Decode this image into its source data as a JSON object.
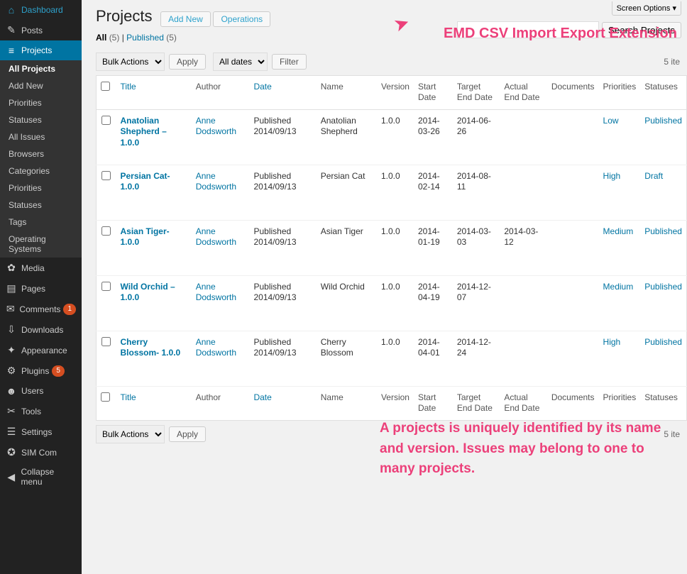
{
  "sidebar": {
    "items": [
      {
        "label": "Dashboard",
        "icon": "⌂"
      },
      {
        "label": "Posts",
        "icon": "✎"
      },
      {
        "label": "Projects",
        "icon": "≡",
        "active": true,
        "submenu": [
          {
            "label": "All Projects",
            "active": true
          },
          {
            "label": "Add New"
          },
          {
            "label": "Priorities"
          },
          {
            "label": "Statuses"
          },
          {
            "label": "All Issues"
          },
          {
            "label": "Browsers"
          },
          {
            "label": "Categories"
          },
          {
            "label": "Priorities"
          },
          {
            "label": "Statuses"
          },
          {
            "label": "Tags"
          },
          {
            "label": "Operating Systems"
          }
        ]
      },
      {
        "label": "Media",
        "icon": "✿"
      },
      {
        "label": "Pages",
        "icon": "▤"
      },
      {
        "label": "Comments",
        "icon": "✉",
        "badge": "1"
      },
      {
        "label": "Downloads",
        "icon": "⇩"
      },
      {
        "label": "Appearance",
        "icon": "✦"
      },
      {
        "label": "Plugins",
        "icon": "⚙",
        "badge": "5"
      },
      {
        "label": "Users",
        "icon": "☻"
      },
      {
        "label": "Tools",
        "icon": "✂"
      },
      {
        "label": "Settings",
        "icon": "☰"
      },
      {
        "label": "SIM Com",
        "icon": "✪"
      },
      {
        "label": "Collapse menu",
        "icon": "◀"
      }
    ]
  },
  "screen_options": "Screen Options ▾",
  "page": {
    "title": "Projects",
    "add_new": "Add New",
    "operations": "Operations"
  },
  "subsub": {
    "all_label": "All",
    "all_count": "(5)",
    "sep": " | ",
    "pub_label": "Published",
    "pub_count": "(5)"
  },
  "filters": {
    "bulk_actions": "Bulk Actions",
    "apply": "Apply",
    "all_dates": "All dates",
    "filter": "Filter",
    "items_count": "5 ite"
  },
  "search": {
    "placeholder": "",
    "button": "Search Projects"
  },
  "columns": {
    "title": "Title",
    "author": "Author",
    "date": "Date",
    "name": "Name",
    "version": "Version",
    "start": "Start Date",
    "target": "Target End Date",
    "actual": "Actual End Date",
    "docs": "Documents",
    "prio": "Priorities",
    "status": "Statuses"
  },
  "rows": [
    {
      "title": "Anatolian Shepherd – 1.0.0",
      "author": "Anne Dodsworth",
      "date": "Published 2014/09/13",
      "name": "Anatolian Shepherd",
      "version": "1.0.0",
      "start": "2014-03-26",
      "target": "2014-06-26",
      "actual": "",
      "docs": "",
      "prio": "Low",
      "status": "Published"
    },
    {
      "title": "Persian Cat- 1.0.0",
      "author": "Anne Dodsworth",
      "date": "Published 2014/09/13",
      "name": "Persian Cat",
      "version": "1.0.0",
      "start": "2014-02-14",
      "target": "2014-08-11",
      "actual": "",
      "docs": "",
      "prio": "High",
      "status": "Draft"
    },
    {
      "title": "Asian Tiger- 1.0.0",
      "author": "Anne Dodsworth",
      "date": "Published 2014/09/13",
      "name": "Asian Tiger",
      "version": "1.0.0",
      "start": "2014-01-19",
      "target": "2014-03-03",
      "actual": "2014-03-12",
      "docs": "",
      "prio": "Medium",
      "status": "Published"
    },
    {
      "title": "Wild Orchid – 1.0.0",
      "author": "Anne Dodsworth",
      "date": "Published 2014/09/13",
      "name": "Wild Orchid",
      "version": "1.0.0",
      "start": "2014-04-19",
      "target": "2014-12-07",
      "actual": "",
      "docs": "",
      "prio": "Medium",
      "status": "Published"
    },
    {
      "title": "Cherry Blossom- 1.0.0",
      "author": "Anne Dodsworth",
      "date": "Published 2014/09/13",
      "name": "Cherry Blossom",
      "version": "1.0.0",
      "start": "2014-04-01",
      "target": "2014-12-24",
      "actual": "",
      "docs": "",
      "prio": "High",
      "status": "Published"
    }
  ],
  "annotations": {
    "arrow": "➤",
    "line1": "EMD CSV Import Export Extension",
    "line2": "A projects is uniquely identified by its name and version. Issues may belong to one to many projects."
  }
}
